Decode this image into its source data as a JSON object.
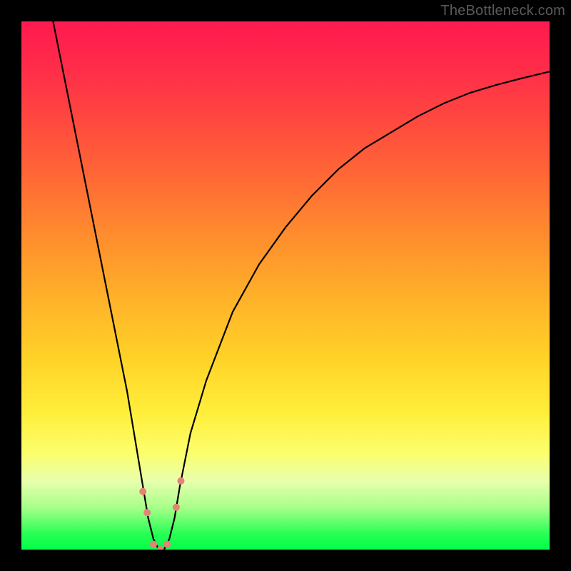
{
  "watermark": "TheBottleneck.com",
  "chart_data": {
    "type": "line",
    "title": "",
    "xlabel": "",
    "ylabel": "",
    "xlim": [
      0,
      100
    ],
    "ylim": [
      0,
      100
    ],
    "series": [
      {
        "name": "bottleneck-curve",
        "x": [
          6,
          8,
          10,
          12,
          14,
          16,
          18,
          20,
          21,
          22,
          23,
          24,
          25,
          26,
          27,
          28,
          29,
          30,
          32,
          35,
          40,
          45,
          50,
          55,
          60,
          65,
          70,
          75,
          80,
          85,
          90,
          95,
          100
        ],
        "y": [
          100,
          90,
          80,
          70,
          60,
          50,
          40,
          30,
          24,
          18,
          12,
          6,
          2,
          0,
          0,
          2,
          6,
          12,
          22,
          32,
          45,
          54,
          61,
          67,
          72,
          76,
          79,
          82,
          84.5,
          86.5,
          88,
          89.3,
          90.5
        ]
      }
    ],
    "markers": [
      {
        "name": "marker-left-upper",
        "x": 23.0,
        "y": 11,
        "r": 5
      },
      {
        "name": "marker-left-lower",
        "x": 23.8,
        "y": 7,
        "r": 5
      },
      {
        "name": "marker-bottom-1",
        "x": 25.0,
        "y": 1,
        "r": 5
      },
      {
        "name": "marker-bottom-2",
        "x": 26.3,
        "y": 0,
        "r": 5
      },
      {
        "name": "marker-bottom-3",
        "x": 27.6,
        "y": 1,
        "r": 5
      },
      {
        "name": "marker-right-lower",
        "x": 29.3,
        "y": 8,
        "r": 5
      },
      {
        "name": "marker-right-upper",
        "x": 30.2,
        "y": 13,
        "r": 5
      }
    ],
    "marker_color": "#e88178",
    "curve_color": "#000000"
  }
}
